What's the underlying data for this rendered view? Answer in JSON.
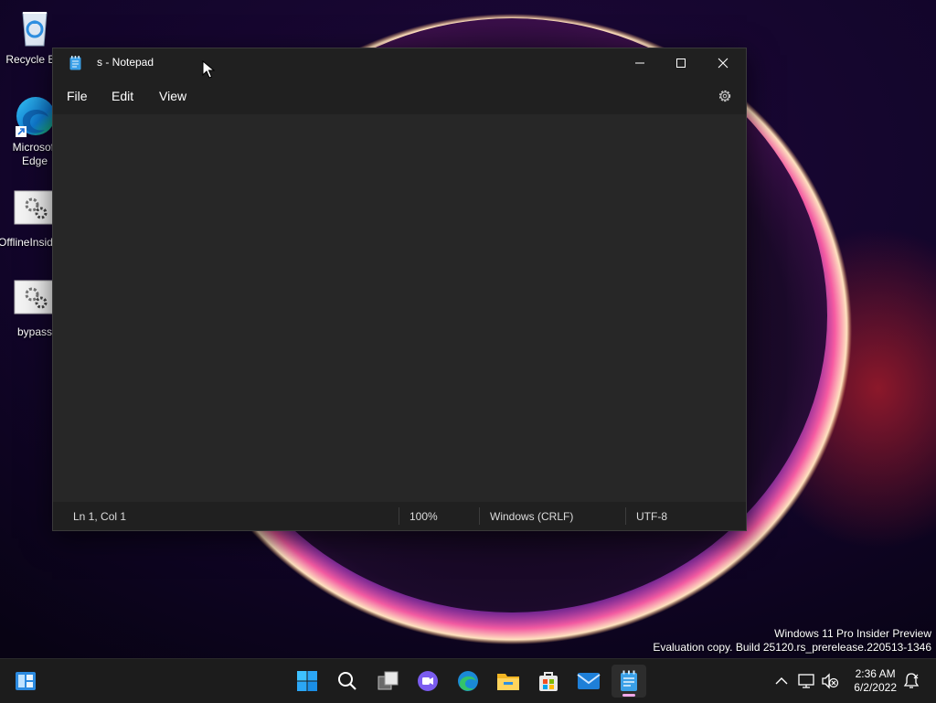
{
  "desktop": {
    "icons": [
      {
        "label": "Recycle Bin",
        "icon": "recycle-bin-icon"
      },
      {
        "label": "Microsoft Edge",
        "icon": "edge-icon"
      },
      {
        "label": "OfflineInsiderEnroll",
        "icon": "settings-shortcut-icon"
      },
      {
        "label": "bypass",
        "icon": "settings-shortcut-icon"
      }
    ]
  },
  "window": {
    "title": "s - Notepad",
    "menu": [
      "File",
      "Edit",
      "View"
    ],
    "editor_text": "",
    "status": {
      "position": "Ln 1, Col 1",
      "zoom": "100%",
      "line_ending": "Windows (CRLF)",
      "encoding": "UTF-8"
    }
  },
  "watermark": {
    "line1": "Windows 11 Pro Insider Preview",
    "line2": "Evaluation copy. Build 25120.rs_prerelease.220513-1346"
  },
  "taskbar": {
    "apps": [
      "widgets-icon",
      "start-icon",
      "search-icon",
      "task-view-icon",
      "chat-icon",
      "edge-icon",
      "file-explorer-icon",
      "store-icon",
      "mail-icon",
      "notepad-icon"
    ],
    "active_app": "notepad-icon",
    "clock": {
      "time": "2:36 AM",
      "date": "6/2/2022"
    },
    "tray": [
      "chevron-up-icon",
      "network-icon",
      "volume-muted-icon",
      "notification-icon"
    ]
  },
  "colors": {
    "window_bg": "#272727",
    "titlebar_bg": "#202020",
    "taskbar_bg": "#1c1c1c",
    "active_indicator": "#f0a7e8"
  }
}
